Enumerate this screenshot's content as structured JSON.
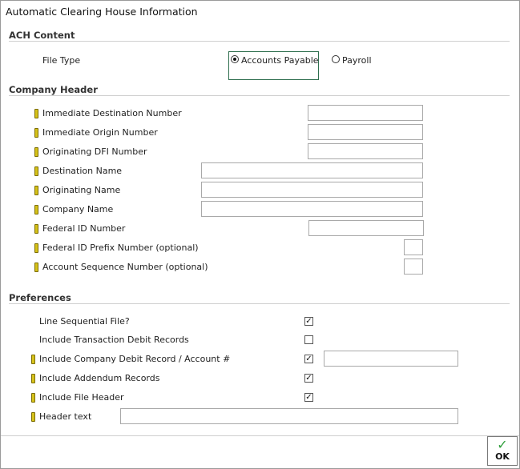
{
  "window": {
    "title": "Automatic Clearing House Information"
  },
  "sections": {
    "ach_content": "ACH Content",
    "company_header": "Company Header",
    "preferences": "Preferences"
  },
  "ach": {
    "file_type_label": "File Type",
    "options": [
      "Accounts Payable",
      "Payroll"
    ],
    "selected": "Accounts Payable"
  },
  "company_header": {
    "fields": [
      {
        "label": "Immediate Destination Number",
        "value": ""
      },
      {
        "label": "Immediate Origin Number",
        "value": ""
      },
      {
        "label": "Originating DFI Number",
        "value": ""
      },
      {
        "label": "Destination Name",
        "value": ""
      },
      {
        "label": "Originating Name",
        "value": ""
      },
      {
        "label": "Company Name",
        "value": ""
      },
      {
        "label": "Federal ID Number",
        "value": ""
      },
      {
        "label": "Federal ID Prefix Number (optional)",
        "value": ""
      },
      {
        "label": "Account Sequence Number (optional)",
        "value": ""
      }
    ]
  },
  "preferences": {
    "items": [
      {
        "label": "Line Sequential File?",
        "checked": true
      },
      {
        "label": "Include Transaction Debit Records",
        "checked": false
      },
      {
        "label": "Include Company Debit Record / Account #",
        "checked": true,
        "value": ""
      },
      {
        "label": "Include Addendum Records",
        "checked": true
      },
      {
        "label": "Include File Header",
        "checked": true
      },
      {
        "label": "Header text",
        "value": ""
      }
    ]
  },
  "footer": {
    "ok_label": "OK",
    "ok_icon": "checkmark-icon",
    "accent": "#2e9e3a"
  }
}
